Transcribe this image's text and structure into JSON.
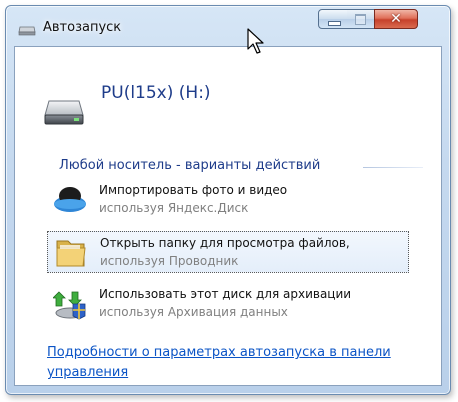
{
  "window": {
    "title": "Автозапуск",
    "controls": {
      "minimize": "minimize",
      "maximize": "maximize",
      "close": "✕"
    }
  },
  "drive": {
    "label": "PU(l15x) (H:)",
    "icon": "usb-drive-icon"
  },
  "section": {
    "title": "Любой носитель - варианты действий"
  },
  "actions": [
    {
      "title": "Импортировать фото и видео",
      "subtitle": "используя Яндекс.Диск",
      "icon": "yandex-disk-icon"
    },
    {
      "title": "Открыть папку для просмотра файлов,",
      "subtitle": "используя Проводник",
      "icon": "folder-icon",
      "selected": true
    },
    {
      "title": "Использовать этот диск для архивации",
      "subtitle": "используя Архивация данных",
      "icon": "backup-icon"
    }
  ],
  "footer": {
    "link": "Подробности о параметрах автозапуска в панели управления"
  },
  "colors": {
    "heading": "#1e3c8a",
    "link": "#0b54c6",
    "subtitle": "#808080",
    "close": "#c7412b"
  }
}
